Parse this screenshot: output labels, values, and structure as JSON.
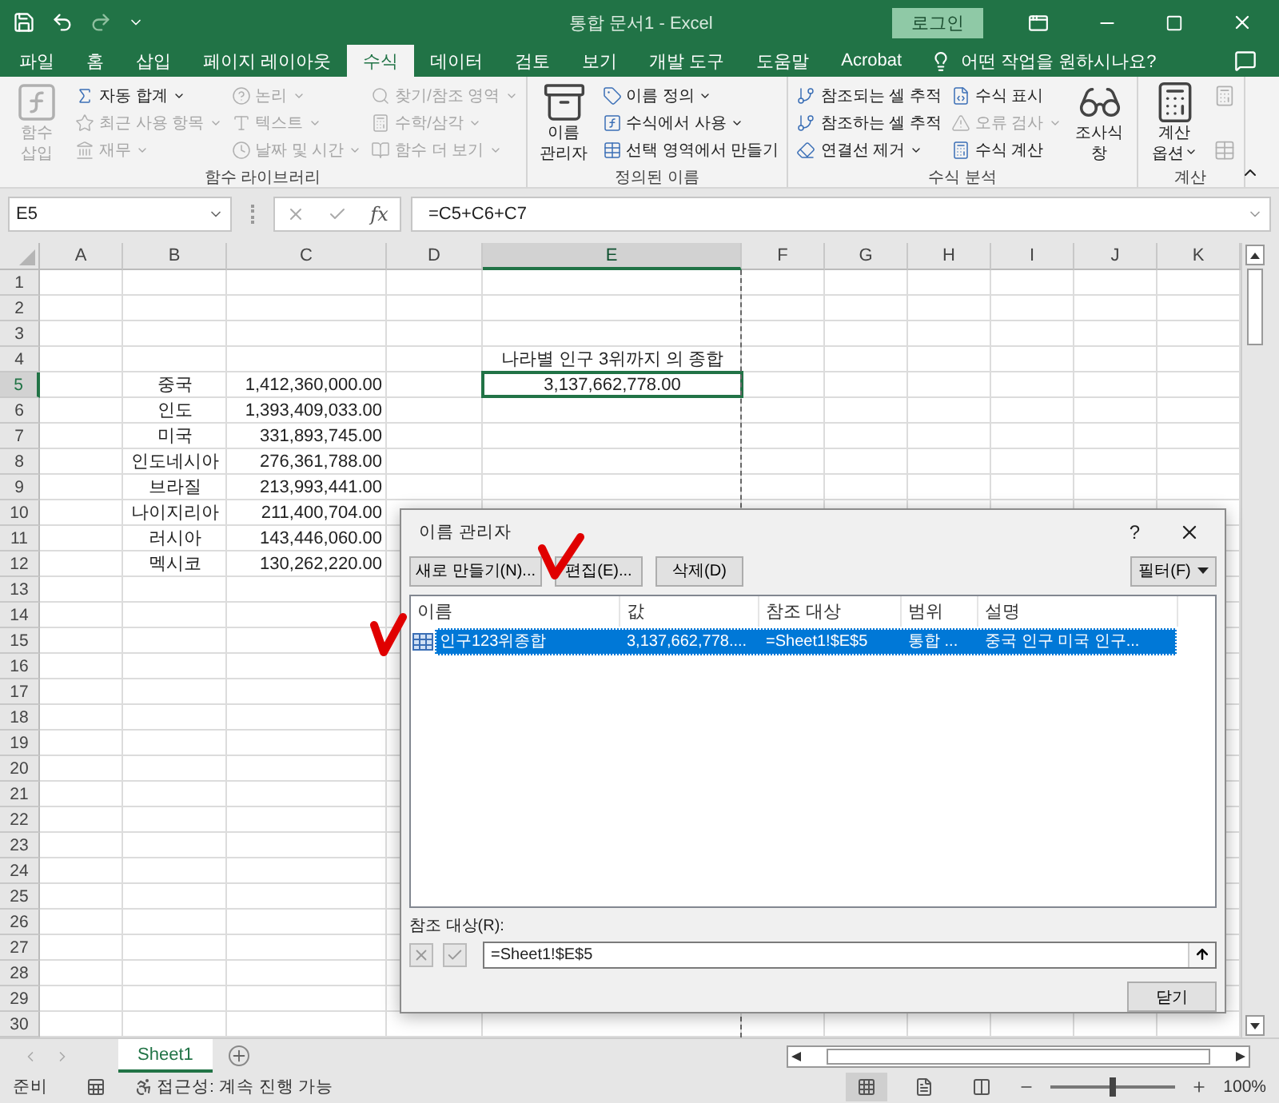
{
  "title_bar": {
    "title": "통합 문서1  -  Excel",
    "login": "로그인"
  },
  "tabs": [
    {
      "label": "파일",
      "selected": false
    },
    {
      "label": "홈",
      "selected": false
    },
    {
      "label": "삽입",
      "selected": false
    },
    {
      "label": "페이지 레이아웃",
      "selected": false
    },
    {
      "label": "수식",
      "selected": true
    },
    {
      "label": "데이터",
      "selected": false
    },
    {
      "label": "검토",
      "selected": false
    },
    {
      "label": "보기",
      "selected": false
    },
    {
      "label": "개발 도구",
      "selected": false
    },
    {
      "label": "도움말",
      "selected": false
    },
    {
      "label": "Acrobat",
      "selected": false
    }
  ],
  "tell_me": "어떤 작업을 원하시나요?",
  "ribbon_groups": [
    {
      "label": "함수 라이브러리",
      "columns": [
        {
          "kind": "large",
          "items": [
            {
              "label": "함수 삽입",
              "disabled": true,
              "caret": false
            }
          ]
        },
        {
          "kind": "stack",
          "items": [
            {
              "label": "자동 합계",
              "disabled": false,
              "caret": true
            },
            {
              "label": "최근 사용 항목",
              "disabled": true,
              "caret": true
            },
            {
              "label": "재무",
              "disabled": true,
              "caret": true
            }
          ]
        },
        {
          "kind": "stack",
          "items": [
            {
              "label": "논리",
              "disabled": true,
              "caret": true
            },
            {
              "label": "텍스트",
              "disabled": true,
              "caret": true
            },
            {
              "label": "날짜 및 시간",
              "disabled": true,
              "caret": true
            }
          ]
        },
        {
          "kind": "stack",
          "items": [
            {
              "label": "찾기/참조 영역",
              "disabled": true,
              "caret": true
            },
            {
              "label": "수학/삼각",
              "disabled": true,
              "caret": true
            },
            {
              "label": "함수 더 보기",
              "disabled": true,
              "caret": true
            }
          ]
        }
      ]
    },
    {
      "label": "정의된 이름",
      "columns": [
        {
          "kind": "large",
          "items": [
            {
              "label": "이름 관리자",
              "disabled": false,
              "caret": false
            }
          ]
        },
        {
          "kind": "stack",
          "items": [
            {
              "label": "이름 정의",
              "disabled": false,
              "caret": true
            },
            {
              "label": "수식에서 사용",
              "disabled": false,
              "caret": true
            },
            {
              "label": "선택 영역에서 만들기",
              "disabled": false,
              "caret": false
            }
          ]
        }
      ]
    },
    {
      "label": "수식 분석",
      "columns": [
        {
          "kind": "stack",
          "items": [
            {
              "label": "참조되는 셀 추적",
              "disabled": false,
              "caret": false
            },
            {
              "label": "참조하는 셀 추적",
              "disabled": false,
              "caret": false
            },
            {
              "label": "연결선 제거",
              "disabled": false,
              "caret": true
            }
          ]
        },
        {
          "kind": "stack",
          "items": [
            {
              "label": "수식 표시",
              "disabled": false,
              "caret": false
            },
            {
              "label": "오류 검사",
              "disabled": true,
              "caret": true
            },
            {
              "label": "수식 계산",
              "disabled": false,
              "caret": false
            }
          ]
        },
        {
          "kind": "large",
          "items": [
            {
              "label": "조사식 창",
              "disabled": false,
              "caret": false
            }
          ]
        }
      ]
    },
    {
      "label": "계산",
      "columns": [
        {
          "kind": "large",
          "items": [
            {
              "label": "계산 옵션",
              "disabled": false,
              "caret": true
            }
          ]
        },
        {
          "kind": "icon_stack",
          "disabled": true
        }
      ]
    }
  ],
  "formula_bar": {
    "name_box": "E5",
    "insert_function": "fx",
    "formula": "=C5+C6+C7"
  },
  "sheet": {
    "columns": [
      {
        "label": "A",
        "selected": false
      },
      {
        "label": "B",
        "selected": false
      },
      {
        "label": "C",
        "selected": false
      },
      {
        "label": "D",
        "selected": false
      },
      {
        "label": "E",
        "selected": true
      },
      {
        "label": "F",
        "selected": false
      },
      {
        "label": "G",
        "selected": false
      },
      {
        "label": "H",
        "selected": false
      },
      {
        "label": "I",
        "selected": false
      },
      {
        "label": "J",
        "selected": false
      },
      {
        "label": "K",
        "selected": false
      }
    ],
    "rows": [
      {
        "number": "1",
        "selected": false
      },
      {
        "number": "2",
        "selected": false
      },
      {
        "number": "3",
        "selected": false
      },
      {
        "number": "4",
        "selected": false,
        "e": "나라별 인구 3위까지 의 종합"
      },
      {
        "number": "5",
        "selected": true,
        "b": "중국",
        "c": "1,412,360,000.00",
        "e": "3,137,662,778.00"
      },
      {
        "number": "6",
        "selected": false,
        "b": "인도",
        "c": "1,393,409,033.00"
      },
      {
        "number": "7",
        "selected": false,
        "b": "미국",
        "c": "331,893,745.00"
      },
      {
        "number": "8",
        "selected": false,
        "b": "인도네시아",
        "c": "276,361,788.00"
      },
      {
        "number": "9",
        "selected": false,
        "b": "브라질",
        "c": "213,993,441.00"
      },
      {
        "number": "10",
        "selected": false,
        "b": "나이지리아",
        "c": "211,400,704.00"
      },
      {
        "number": "11",
        "selected": false,
        "b": "러시아",
        "c": "143,446,060.00"
      },
      {
        "number": "12",
        "selected": false,
        "b": "멕시코",
        "c": "130,262,220.00"
      },
      {
        "number": "13",
        "selected": false
      },
      {
        "number": "14",
        "selected": false
      },
      {
        "number": "15",
        "selected": false
      },
      {
        "number": "16",
        "selected": false
      },
      {
        "number": "17",
        "selected": false
      },
      {
        "number": "18",
        "selected": false
      },
      {
        "number": "19",
        "selected": false
      },
      {
        "number": "20",
        "selected": false
      },
      {
        "number": "21",
        "selected": false
      },
      {
        "number": "22",
        "selected": false
      },
      {
        "number": "23",
        "selected": false
      },
      {
        "number": "24",
        "selected": false
      },
      {
        "number": "25",
        "selected": false
      },
      {
        "number": "26",
        "selected": false
      },
      {
        "number": "27",
        "selected": false
      },
      {
        "number": "28",
        "selected": false
      },
      {
        "number": "29",
        "selected": false
      },
      {
        "number": "30",
        "selected": false
      }
    ]
  },
  "name_manager": {
    "title": "이름 관리자",
    "help": "?",
    "buttons": [
      "새로 만들기(N)...",
      "편집(E)...",
      "삭제(D)"
    ],
    "filter": "필터(F)",
    "columns": [
      "이름",
      "값",
      "참조 대상",
      "범위",
      "설명"
    ],
    "rows": [
      {
        "name": "인구123위종합",
        "value": "3,137,662,778....",
        "refers_to": "=Sheet1!$E$5",
        "scope": "통합 ...",
        "comment": "중국 인구 미국 인구...",
        "selected": true
      }
    ],
    "refers_label": "참조 대상(R):",
    "refers_value": "=Sheet1!$E$5",
    "close": "닫기"
  },
  "sheet_tabs": [
    {
      "label": "Sheet1",
      "selected": true
    }
  ],
  "status_bar": {
    "ready": "준비",
    "accessibility": "접근성: 계속 진행 가능",
    "zoom": {
      "level": 0.5,
      "reading": "100%"
    }
  }
}
